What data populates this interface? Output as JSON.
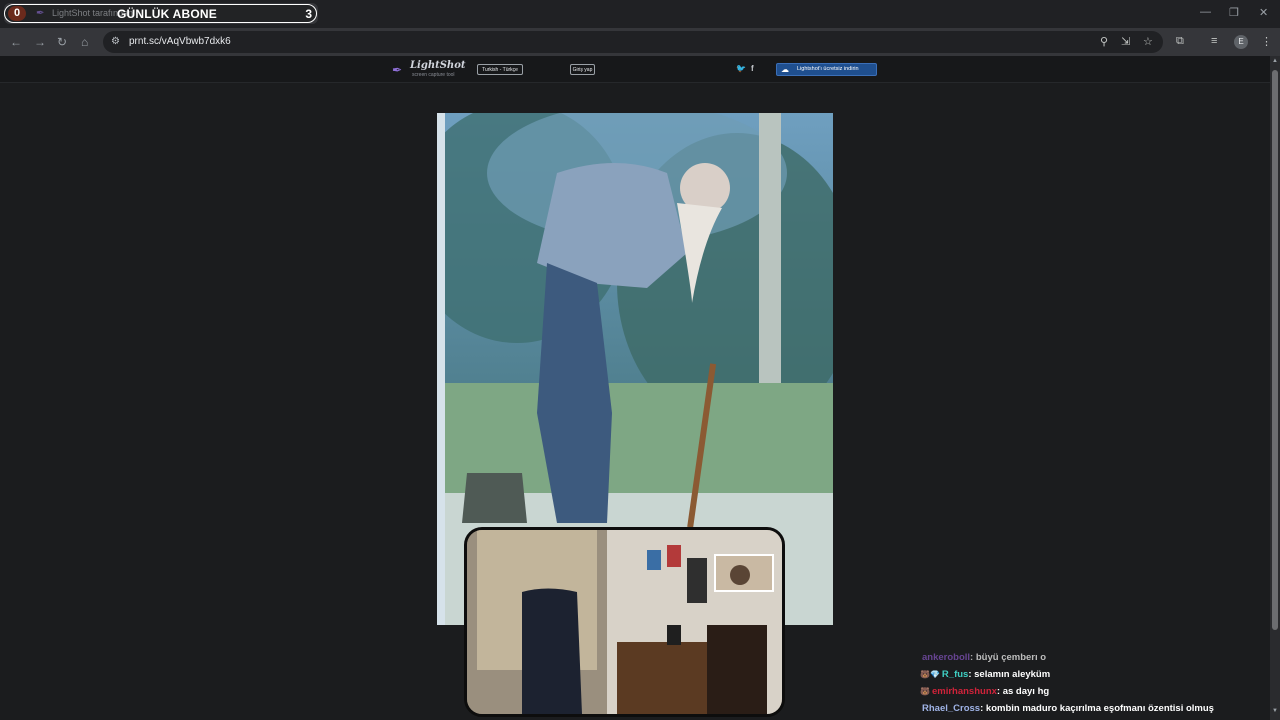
{
  "browser": {
    "tab_title": "LightShot tarafından",
    "url": "prnt.sc/vAqVbwb7dxk6",
    "profile_initial": "E"
  },
  "overlay": {
    "left_count": "0",
    "title": "GÜNLÜK ABONE",
    "right_count": "3"
  },
  "lightshot": {
    "logo_text": "LightShot",
    "logo_tagline": "screen capture tool",
    "language": "Turkish - Türkçe",
    "login": "Giriş yap",
    "download": "Lightshot'ı ücretsiz indirin"
  },
  "chat": [
    {
      "user": "ankeroboll",
      "text": "büyü çemberı o",
      "user_color": "#7a4fb0",
      "badge": ""
    },
    {
      "user": "R_fus",
      "text": "selamın aleyküm",
      "user_color": "#3fd0c4",
      "badge": "🐻💎"
    },
    {
      "user": "emirhanshunx",
      "text": "as dayı hg",
      "user_color": "#d0233a",
      "badge": "🐻"
    },
    {
      "user": "Rhael_Cross",
      "text": "kombin maduro kaçırılma eşofmanı özentisi olmuş",
      "user_color": "#9fb3e6",
      "badge": ""
    }
  ],
  "colors": {
    "page_bg": "#1b1c1e",
    "download_button": "#1f4f8f",
    "overlay_count_bg": "#6b2a1c"
  }
}
